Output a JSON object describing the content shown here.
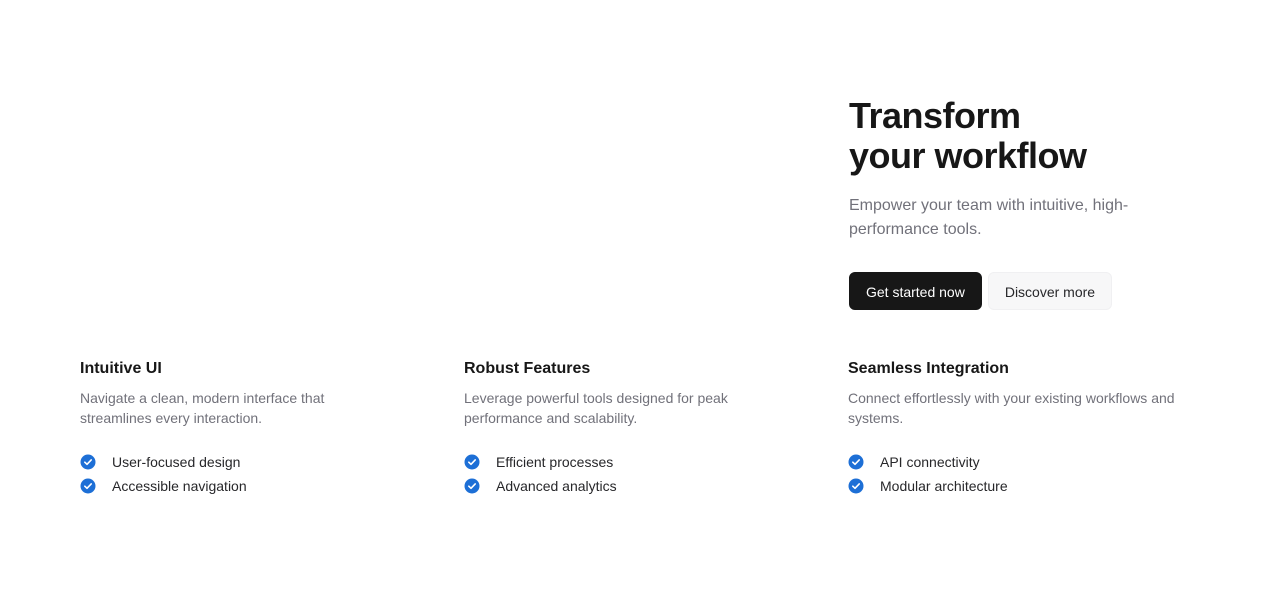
{
  "hero": {
    "title_line1": "Transform",
    "title_line2": "your workflow",
    "subtitle": "Empower your team with intuitive, high-performance tools.",
    "primary_button": "Get started now",
    "secondary_button": "Discover more"
  },
  "features": [
    {
      "title": "Intuitive UI",
      "description": "Navigate a clean, modern interface that streamlines every interaction.",
      "items": [
        "User-focused design",
        "Accessible navigation"
      ]
    },
    {
      "title": "Robust Features",
      "description": "Leverage powerful tools designed for peak performance and scalability.",
      "items": [
        "Efficient processes",
        "Advanced analytics"
      ]
    },
    {
      "title": "Seamless Integration",
      "description": "Connect effortlessly with your existing workflows and systems.",
      "items": [
        "API connectivity",
        "Modular architecture"
      ]
    }
  ],
  "colors": {
    "accent": "#1d6fd6",
    "primary_button_bg": "#171717",
    "secondary_button_bg": "#f7f7f8",
    "muted_text": "#71717a"
  },
  "icons": {
    "list_item": "check-circle-icon"
  }
}
